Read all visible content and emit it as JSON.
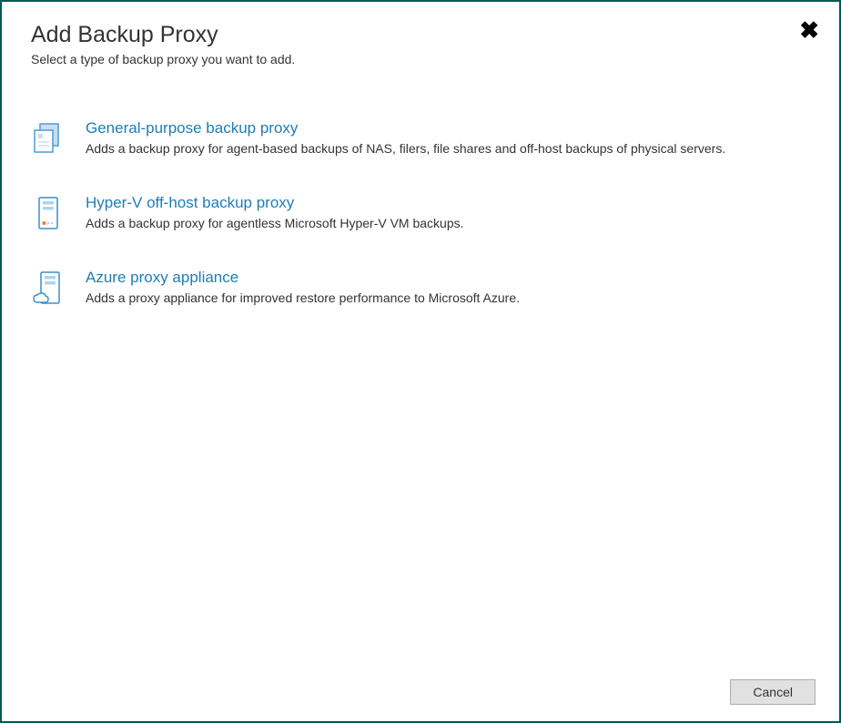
{
  "header": {
    "title": "Add Backup Proxy",
    "subtitle": "Select a type of backup proxy you want to add."
  },
  "options": [
    {
      "label": "General-purpose backup proxy",
      "description": "Adds a backup proxy for agent-based backups of NAS, filers, file shares and off-host backups of physical servers."
    },
    {
      "label": "Hyper-V off-host backup proxy",
      "description": "Adds a backup proxy for agentless Microsoft Hyper-V VM backups."
    },
    {
      "label": "Azure proxy appliance",
      "description": "Adds a proxy appliance for improved restore performance to Microsoft Azure."
    }
  ],
  "buttons": {
    "cancel": "Cancel"
  }
}
